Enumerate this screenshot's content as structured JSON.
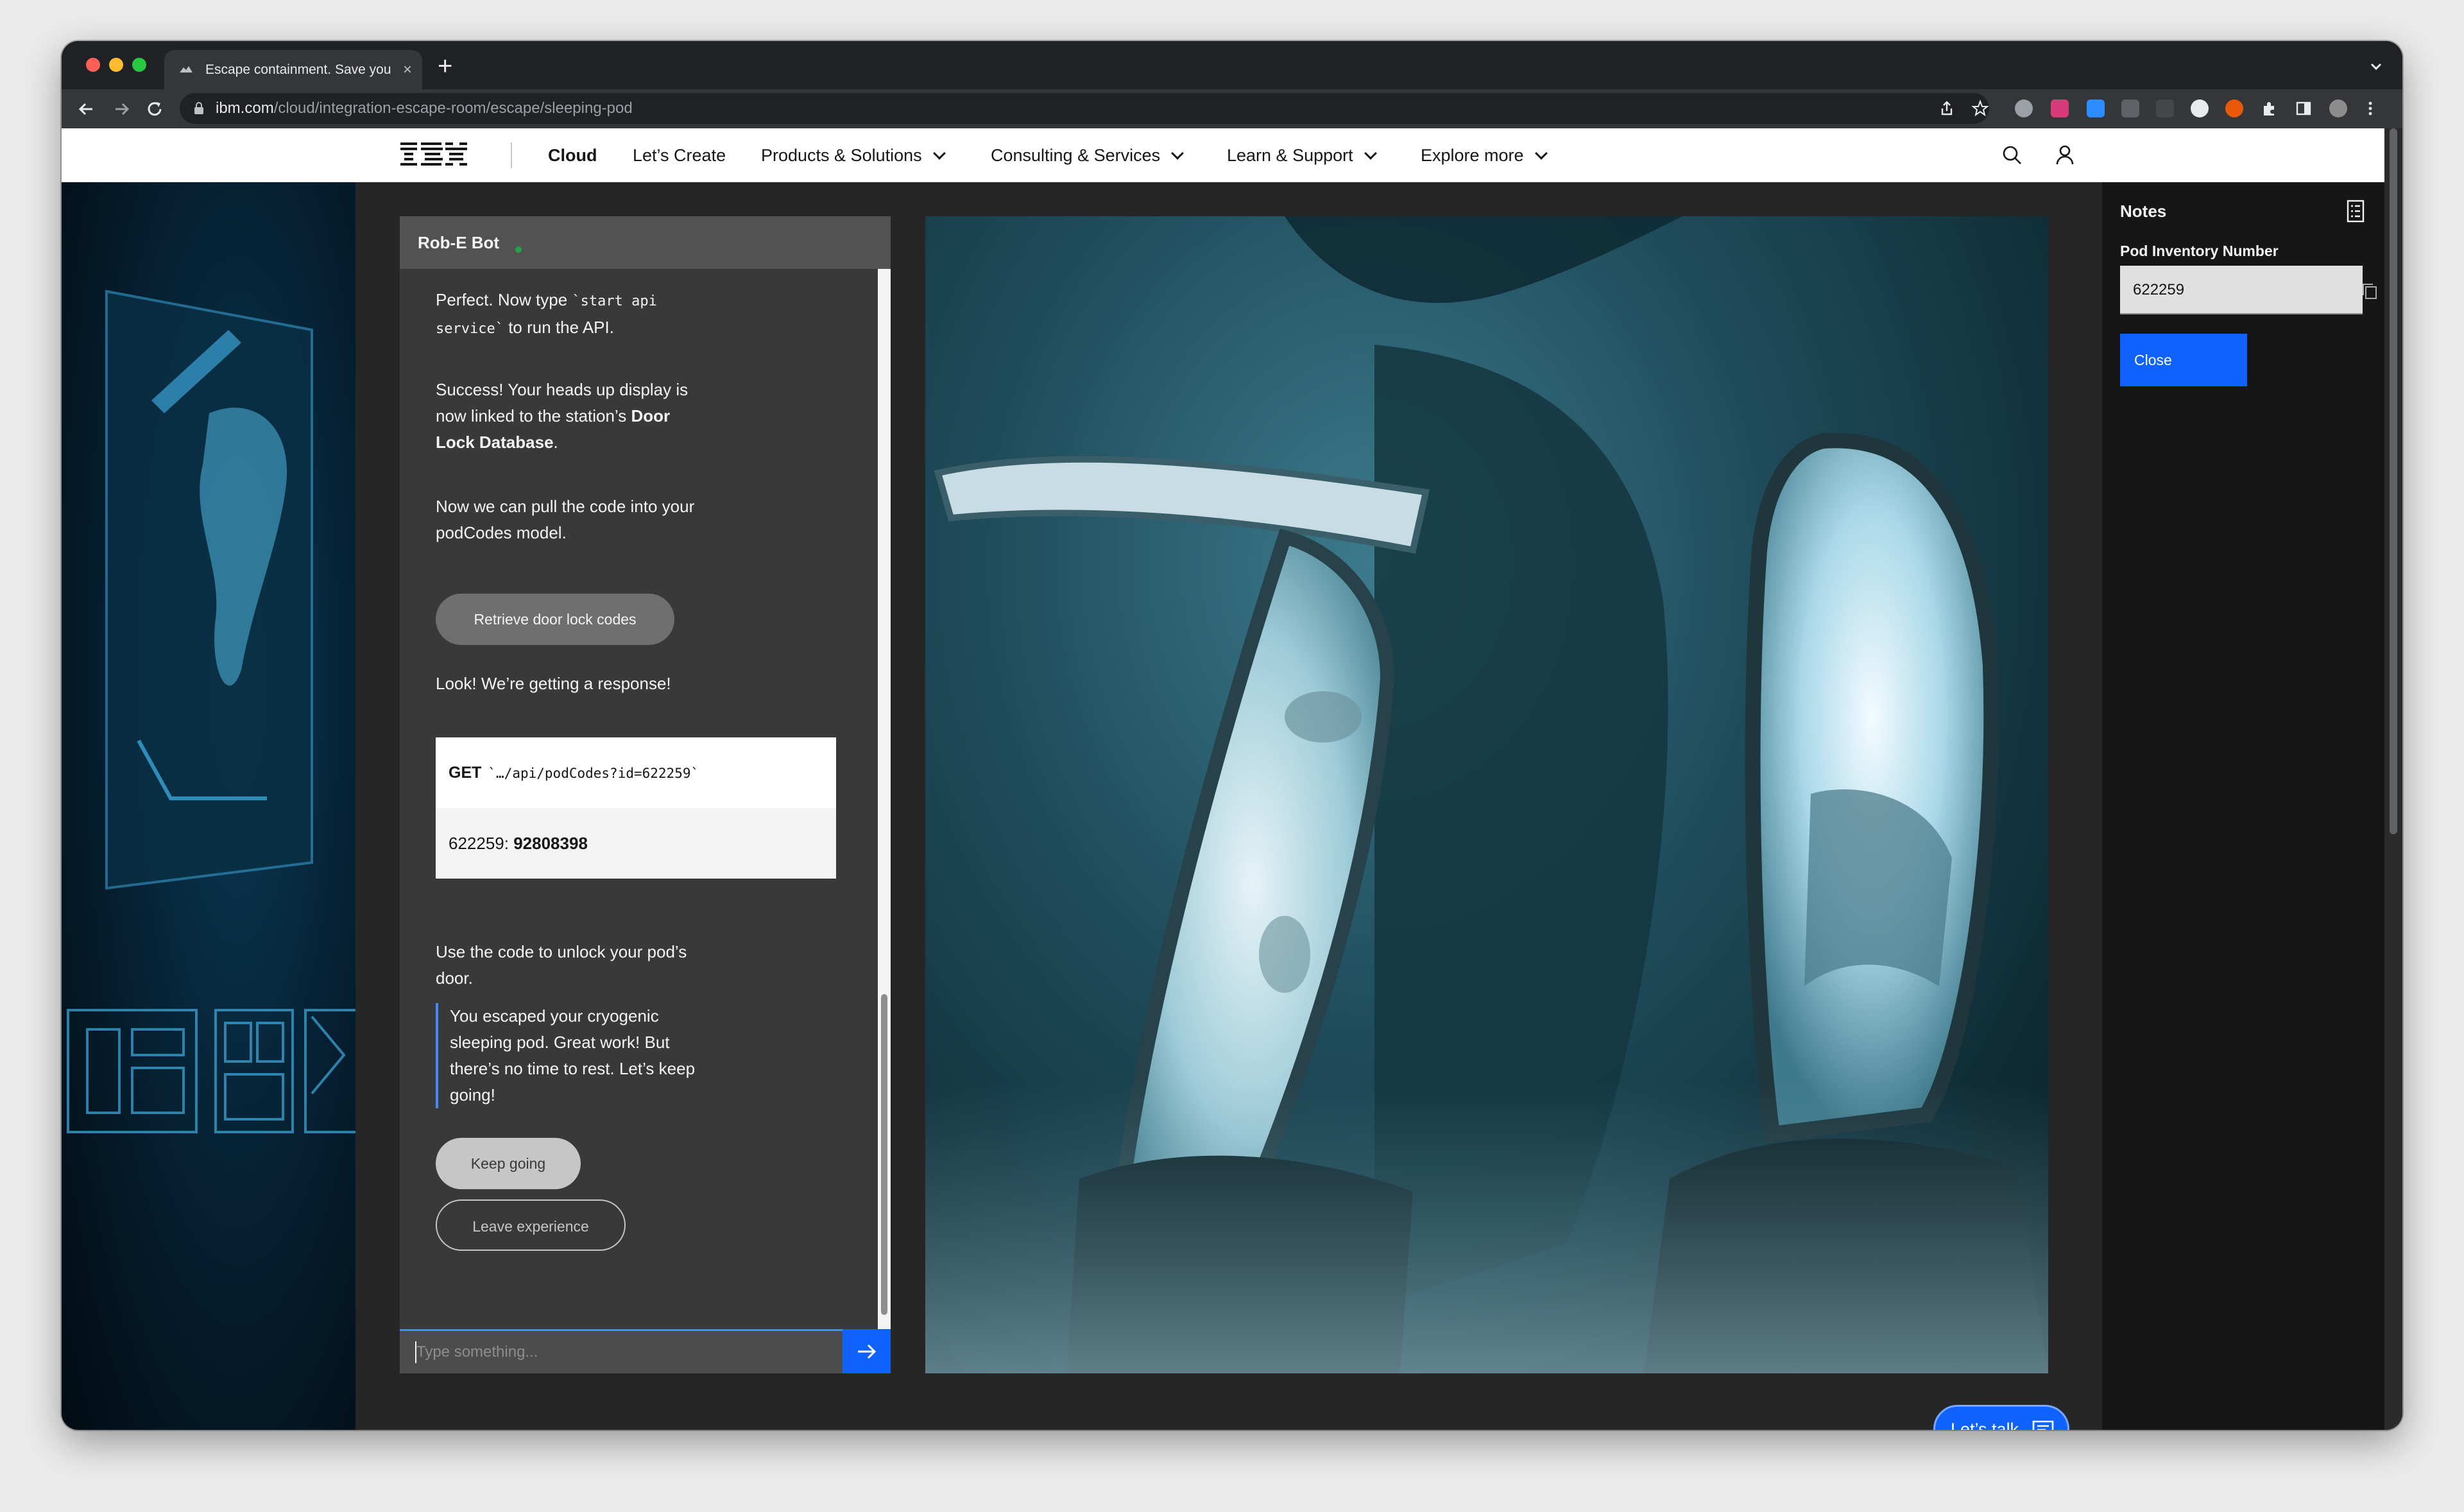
{
  "browser": {
    "tab_title": "Escape containment. Save you",
    "tab_close": "×",
    "new_tab": "+",
    "url_host": "ibm.com",
    "url_path": "/cloud/integration-escape-room/escape/sleeping-pod",
    "traffic_lights": {
      "close": "#ff5f57",
      "minimize": "#febc2e",
      "zoom": "#28c840"
    }
  },
  "masthead": {
    "logo": "IBM",
    "items": [
      {
        "label": "Cloud",
        "dropdown": false
      },
      {
        "label": "Let’s Create",
        "dropdown": false
      },
      {
        "label": "Products & Solutions",
        "dropdown": true
      },
      {
        "label": "Consulting & Services",
        "dropdown": true
      },
      {
        "label": "Learn & Support",
        "dropdown": true
      },
      {
        "label": "Explore more",
        "dropdown": true
      }
    ]
  },
  "chat": {
    "bot_name": "Rob-E Bot",
    "messages": {
      "m1_a": "Perfect. Now type ",
      "m1_code": "`start api service`",
      "m1_b": " to run the API.",
      "m2_a": "Success! Your heads up display is now linked to the station’s ",
      "m2_bold": "Door Lock Database",
      "m2_b": ".",
      "m3": "Now we can pull the code into your podCodes model.",
      "m4": "Look! We’re getting a response!",
      "m5": "Use the code to unlock your pod’s door.",
      "m6": "You escaped your cryogenic sleeping pod. Great work! But there’s no time to rest. Let’s keep going!"
    },
    "retrieve_button": "Retrieve door lock codes",
    "api": {
      "method": "GET",
      "path": "`…/api/podCodes?id=622259`",
      "result_key": "622259: ",
      "result_value": "92808398"
    },
    "keep_button": "Keep going",
    "leave_button": "Leave experience",
    "input_placeholder": "Type something..."
  },
  "notes": {
    "title": "Notes",
    "pod_label": "Pod Inventory Number",
    "pod_value": "622259",
    "close_button": "Close"
  },
  "lets_talk": "Let’s talk",
  "colors": {
    "accent_blue": "#0f62fe",
    "panel_dark": "#393939",
    "page_bg": "#262626",
    "notes_bg": "#161616"
  },
  "icons": [
    "back-arrow-icon",
    "forward-arrow-icon",
    "reload-icon",
    "lock-icon",
    "search-icon",
    "user-icon",
    "send-arrow-icon",
    "notes-list-icon",
    "copy-icon",
    "chat-bubble-icon"
  ]
}
